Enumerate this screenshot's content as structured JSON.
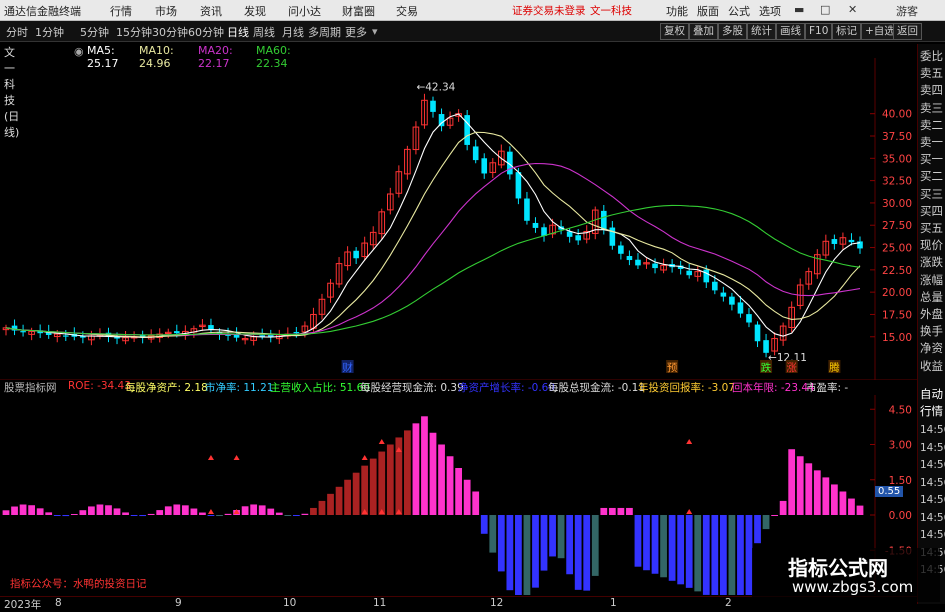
{
  "window": {
    "app_title": "通达信金融终端",
    "menu": [
      "行情",
      "市场",
      "资讯",
      "发现",
      "问小达",
      "财富圈",
      "交易"
    ],
    "login_warning": "证券交易未登录",
    "stock_title": "文一科技",
    "right_menu": [
      "功能",
      "版面",
      "公式",
      "选项"
    ],
    "guest": "游客"
  },
  "toolbar": {
    "timeframes": [
      "分时",
      "1分钟",
      "5分钟",
      "15分钟",
      "30分钟",
      "60分钟",
      "日线",
      "周线",
      "月线",
      "多周期",
      "更多"
    ],
    "active_timeframe": "日线",
    "buttons": [
      "复权",
      "叠加",
      "多股",
      "统计",
      "画线",
      "F10",
      "标记",
      "+自选",
      "返回"
    ]
  },
  "stock_bar": {
    "name": "文一科技(日线)",
    "ma5": "MA5: 25.17",
    "ma10": "MA10: 24.96",
    "ma20": "MA20: 22.17",
    "ma60": "MA60: 22.34"
  },
  "price_axis": [
    "40.00",
    "37.50",
    "35.00",
    "32.50",
    "30.00",
    "27.50",
    "25.00",
    "22.50",
    "20.00",
    "17.50",
    "15.00"
  ],
  "annotations": {
    "high": "42.34",
    "low": "12.11"
  },
  "event_markers": [
    "财",
    "预",
    "跌",
    "涨",
    "腾"
  ],
  "indicator_bar": {
    "name": "股票指标网",
    "roe": "ROE: -34.43",
    "eps_assets": "每股净资产: 2.18",
    "pe": "市净率: 11.21",
    "main_income": "主营收入占比: 51.60",
    "op_cashflow": "每股经营现金流: 0.39",
    "vol_ratio": "净资产增长率: -0.69",
    "total_cash": "每股总现金流: -0.11",
    "roi": "年投资回报率: -3.07",
    "annual_return": "回本年限: -23.44",
    "pe_ratio": "市盈率: -"
  },
  "indicator_axis": [
    "4.50",
    "3.00",
    "1.50",
    "0.00",
    "-1.50"
  ],
  "indicator_value": "0.55",
  "indicator_label": "指标公众号：水鸭的投资日记",
  "date_axis": [
    "2023年",
    "8",
    "9",
    "10",
    "11",
    "12",
    "1",
    "2"
  ],
  "side_tabs": [
    "委比",
    "卖五",
    "卖四",
    "卖三",
    "卖二",
    "卖一",
    "买一",
    "买二",
    "买三",
    "买四",
    "买五",
    "现价",
    "涨跌",
    "涨幅",
    "总量",
    "外盘",
    "换手",
    "净资",
    "收益"
  ],
  "side_bottom": [
    "自动",
    "行情"
  ],
  "side_times": [
    "14:56",
    "14:56",
    "14:56",
    "14:56",
    "14:56",
    "14:56",
    "14:56",
    "14:56",
    "14:56"
  ],
  "watermark": {
    "title": "指标公式网",
    "url": "www.zbgs3.com"
  },
  "colors": {
    "up": "#ff3333",
    "down": "#00e5ff",
    "ma5": "#ffffff",
    "ma10": "#e8e8a0",
    "ma20": "#cc33cc",
    "ma60": "#33cc33",
    "pos_bar": "#ff33cc",
    "neg_bar": "#3333ff",
    "price_axis": "#ff4444"
  },
  "chart_data": {
    "type": "candlestick",
    "close": [
      16.0,
      15.7,
      15.5,
      15.6,
      15.4,
      15.2,
      15.3,
      15.1,
      15.0,
      14.9,
      15.1,
      15.2,
      15.0,
      14.8,
      14.9,
      15.0,
      14.9,
      15.1,
      15.3,
      15.5,
      15.4,
      15.6,
      15.9,
      16.3,
      15.8,
      15.3,
      15.1,
      14.9,
      14.8,
      15.0,
      15.1,
      15.0,
      15.2,
      15.3,
      15.5,
      16.2,
      17.5,
      19.2,
      21.0,
      23.2,
      24.5,
      23.8,
      25.5,
      26.7,
      29.0,
      31.0,
      33.5,
      36.0,
      38.5,
      41.5,
      40.2,
      38.6,
      39.5,
      40.0,
      36.5,
      34.8,
      33.3,
      34.5,
      35.8,
      33.2,
      30.5,
      28.0,
      27.2,
      26.3,
      27.5,
      27.0,
      26.2,
      25.8,
      26.8,
      29.2,
      27.0,
      25.2,
      24.3,
      23.6,
      23.0,
      23.3,
      22.7,
      23.0,
      22.8,
      22.6,
      21.9,
      22.3,
      21.1,
      20.2,
      19.5,
      18.6,
      17.6,
      16.6,
      14.5,
      13.2,
      14.8,
      16.2,
      18.3,
      20.8,
      22.3,
      24.2,
      25.7,
      25.4,
      26.1,
      25.6,
      24.9
    ],
    "ma60_note": "approximate MA curves computed from close"
  }
}
